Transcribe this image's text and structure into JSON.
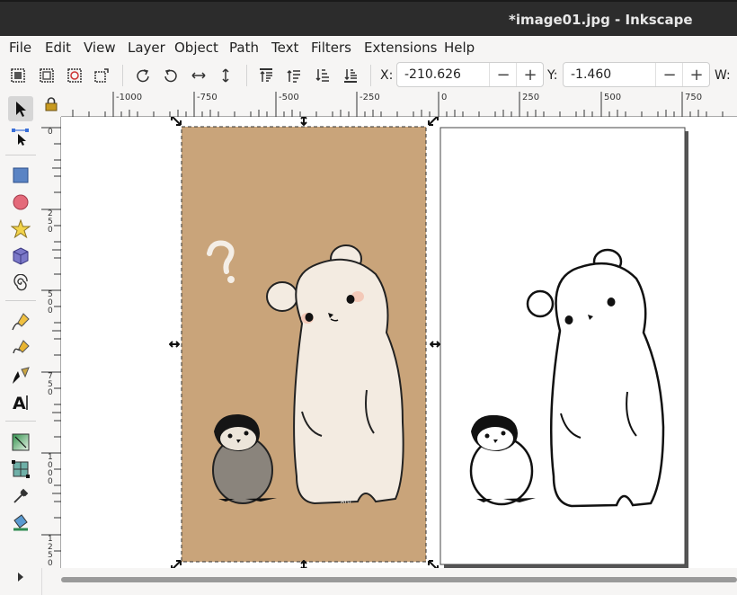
{
  "window": {
    "title": "*image01.jpg - Inkscape"
  },
  "menu": [
    "File",
    "Edit",
    "View",
    "Layer",
    "Object",
    "Path",
    "Text",
    "Filters",
    "Extensions",
    "Help"
  ],
  "toolbar": {
    "x_label": "X:",
    "x_value": "-210.626",
    "y_label": "Y:",
    "y_value": "-1.460",
    "w_label": "W:",
    "minus": "−",
    "plus": "+"
  },
  "ruler": {
    "h_labels": [
      "-1000",
      "-750",
      "-500",
      "-250",
      "0",
      "250",
      "500",
      "750"
    ],
    "v_labels": [
      "0",
      "2\n5\n0",
      "5\n0\n0",
      "7\n5\n0",
      "1\n0\n0\n0",
      "1\n2\n5\n0"
    ]
  },
  "artwork": {
    "signature": "AYU",
    "question_mark": "?"
  },
  "colors": {
    "paper_brown": "#c9a47a",
    "bear_cream": "#f3ebe1",
    "penguin_gray": "#8a847c",
    "titlebar": "#2c2c2c"
  }
}
